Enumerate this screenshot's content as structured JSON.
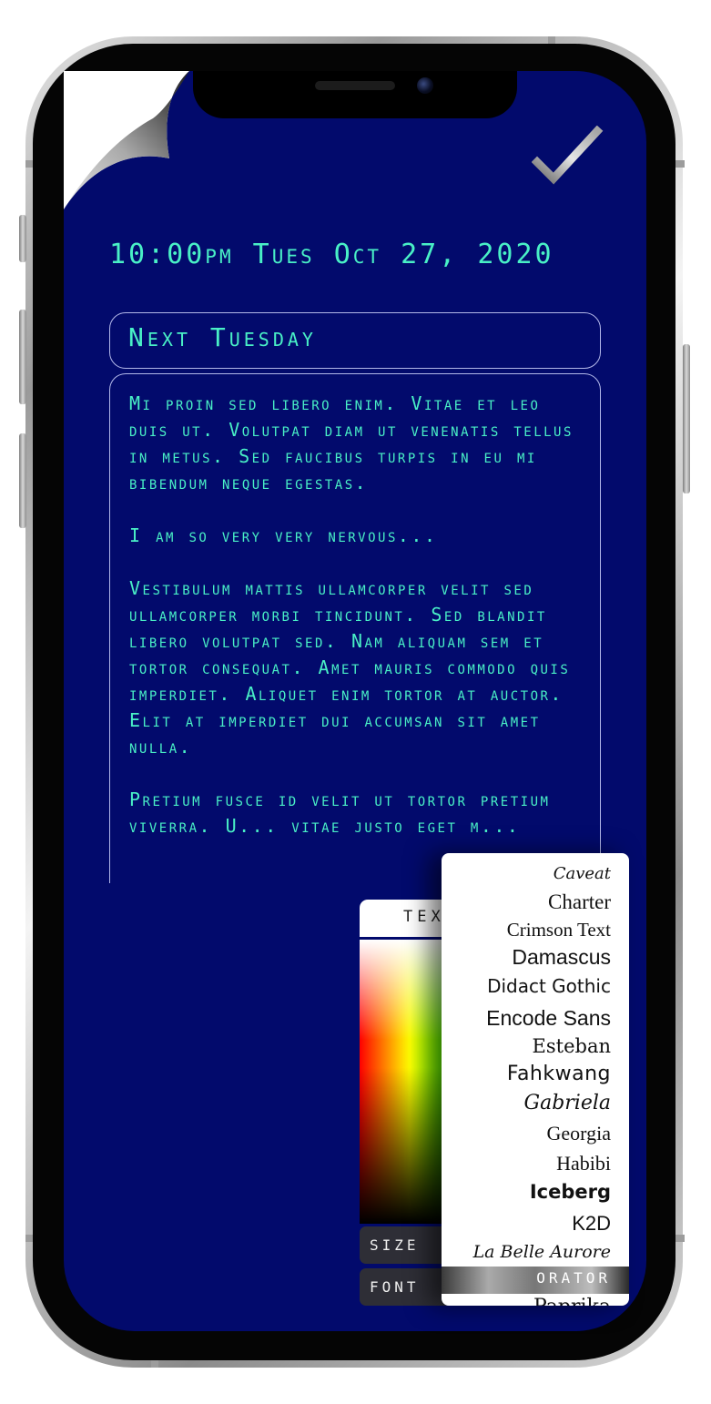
{
  "note": {
    "timestamp": "10:00pm Tues Oct 27, 2020",
    "title": "Next Tuesday",
    "paragraphs": [
      "Mi proin sed libero enim. Vitae et leo duis ut. Volutpat diam ut venenatis tellus in metus. Sed faucibus turpis in eu mi bibendum neque egestas.",
      "I am so very very nervous...",
      "Vestibulum mattis ullamcorper velit sed ullamcorper morbi tincidunt. Sed blandit libero volutpat sed. Nam aliquam sem et tortor consequat. Amet mauris commodo quis imperdiet. Aliquet enim tortor at auctor. Elit at imperdiet dui accumsan sit amet nulla.",
      "Pretium fusce id velit ut tortor pretium viverra. U... vitae justo eget m..."
    ]
  },
  "color_panel": {
    "tab_label": "TEX",
    "size_label": "SIZE",
    "font_label": "FONT"
  },
  "font_picker": {
    "items": [
      "Caveat",
      "Charter",
      "Crimson Text",
      "Damascus",
      "Didact Gothic",
      "Encode Sans",
      "Esteban",
      "Fahkwang",
      "Gabriela",
      "Georgia",
      "Habibi",
      "Iceberg",
      "K2D",
      "La Belle Aurore",
      "ORATOR",
      "Paprika"
    ],
    "selected": "ORATOR"
  },
  "colors": {
    "screen_background": "#020a6c",
    "text_accent": "#49f0c6",
    "box_border": "#d2d7ff"
  },
  "icons": [
    "page-curl-icon",
    "checkmark-icon"
  ]
}
